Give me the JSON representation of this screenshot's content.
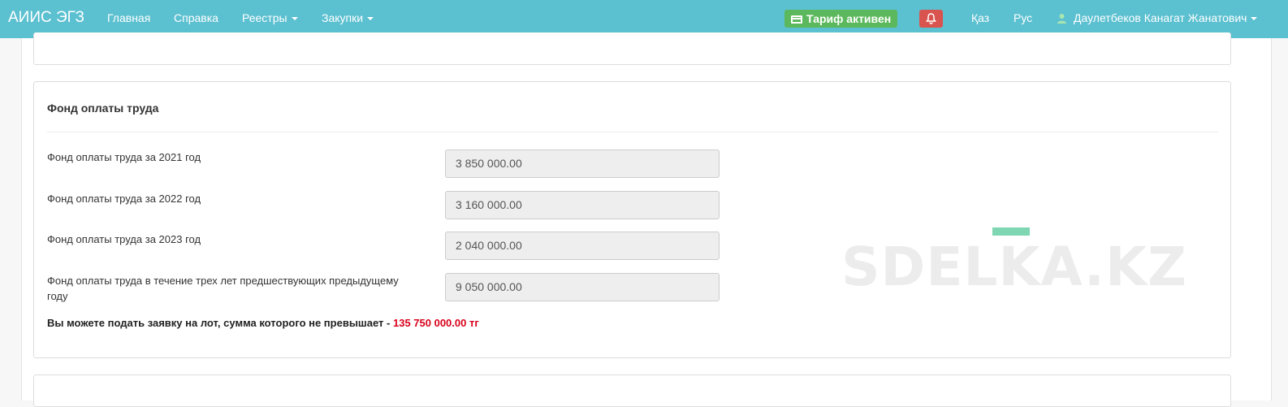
{
  "navbar": {
    "brand": "АИИС ЭГЗ",
    "links": [
      "Главная",
      "Справка"
    ],
    "dropdowns": [
      "Реестры",
      "Закупки"
    ],
    "tariff_label": "Тариф активен",
    "lang_kz": "Қаз",
    "lang_ru": "Рус",
    "user_name": "Даулетбеков Канагат Жанатович"
  },
  "payroll": {
    "title": "Фонд оплаты труда",
    "rows": [
      {
        "label": "Фонд оплаты труда за 2021 год",
        "value": "3 850 000.00"
      },
      {
        "label": "Фонд оплаты труда за 2022 год",
        "value": "3 160 000.00"
      },
      {
        "label": "Фонд оплаты труда за 2023 год",
        "value": "2 040 000.00"
      },
      {
        "label": "Фонд оплаты труда в течение трех лет предшествующих предыдущему году",
        "value": "9 050 000.00"
      }
    ],
    "notice_text": "Вы можете подать заявку на лот, сумма которого не превышает - ",
    "notice_amount": "135 750 000.00 тг"
  },
  "watermark": "SDELKA.KZ",
  "colors": {
    "navbar": "#5bc0d0",
    "tariff_badge": "#5cb85c",
    "bell_button": "#d9534f",
    "limit_amount": "#d9001b"
  }
}
